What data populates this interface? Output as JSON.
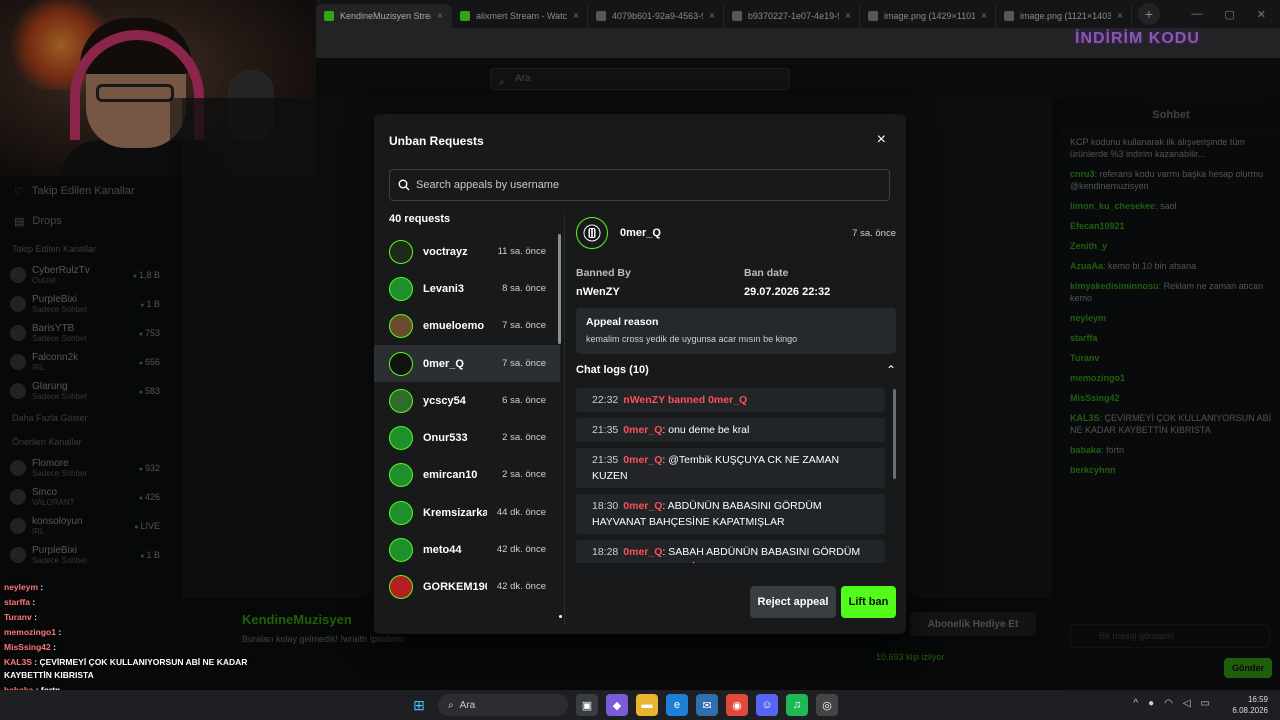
{
  "browser": {
    "tabs": [
      {
        "label": "KendineMuzisyen Stream",
        "color": "#53fc18",
        "active": true
      },
      {
        "label": "alixmert Stream - Watch",
        "color": "#53fc18",
        "active": false
      },
      {
        "label": "4079b601-92a9-4563-9b",
        "color": "#888888",
        "active": false
      },
      {
        "label": "b9370227-1e07-4e19-9b",
        "color": "#888888",
        "active": false
      },
      {
        "label": "image.png (1429×1101)",
        "color": "#888888",
        "active": false
      },
      {
        "label": "image.png (1121×1403)",
        "color": "#888888",
        "active": false
      }
    ],
    "new_tab": "+"
  },
  "site": {
    "search_placeholder": "Ara",
    "promo": "İNDİRİM KODU"
  },
  "left_sidebar": {
    "nav_followed": "Takip Edilen Kanallar",
    "nav_drops": "Drops",
    "followed_heading": "Takip Edilen Kanallar",
    "followed": [
      {
        "name": "CyberRulzTv",
        "cat": "Outzel",
        "viewers": "1,8 B"
      },
      {
        "name": "PurpleBixi",
        "cat": "Sadece Sohbet",
        "viewers": "1 B"
      },
      {
        "name": "BarisYTB",
        "cat": "Sadece Sohbet",
        "viewers": "753"
      },
      {
        "name": "Falconn2k",
        "cat": "IRL",
        "viewers": "656"
      },
      {
        "name": "Glarung",
        "cat": "Sadece Sohbet",
        "viewers": "583"
      }
    ],
    "more": "Daha Fazla Göster",
    "recommended_heading": "Önerilen Kanallar",
    "recommended": [
      {
        "name": "Flomore",
        "cat": "Sadece Sohbet",
        "viewers": "932"
      },
      {
        "name": "Sinco",
        "cat": "VALORANT",
        "viewers": "426"
      },
      {
        "name": "konsoloyun",
        "cat": "IRL",
        "viewers": "LIVE"
      },
      {
        "name": "PurpleBixi",
        "cat": "Sadece Sohbet",
        "viewers": "1 B"
      }
    ]
  },
  "overlay_chat": [
    {
      "user": "neyleym",
      "text": ""
    },
    {
      "user": "starffa",
      "text": ""
    },
    {
      "user": "Turanv",
      "text": ""
    },
    {
      "user": "memozingo1",
      "text": ""
    },
    {
      "user": "MisSsing42",
      "text": ""
    },
    {
      "user": "KAL3S",
      "text": "ÇEVİRMEYİ ÇOK KULLANIYORSUN ABİ NE KADAR KAYBETTİN KIBRISTA"
    },
    {
      "user": "babaka",
      "text": "fortn"
    },
    {
      "user": "berkcyhnn",
      "text": ""
    }
  ],
  "stream": {
    "streamer": "KendineMuzisyen",
    "title": "Buraları kolay gelmedik! !wraith !pindirim",
    "category": "Sadece Sohbet",
    "lang": "Turkish",
    "viewers": "10.693 kişi izliyor",
    "sub_button": "Abonelik Hediye Et"
  },
  "right_chat": {
    "title": "Sohbet",
    "pinned": "KCP kodunu kullanarak ilk alışverişinde tüm ürünlerde %3 indirim kazanabilir...",
    "messages": [
      {
        "user": "cnru3",
        "text": "referans kodu varmı başka hesap olurmu @kendinemuzisyen"
      },
      {
        "user": "limon_ku_chesekee",
        "text": "saol"
      },
      {
        "user": "Efecan10921",
        "text": ""
      },
      {
        "user": "Zenith_y",
        "text": ""
      },
      {
        "user": "AzuaAa",
        "text": "kemo bi 10 bin atsana"
      },
      {
        "user": "kimyakedisiminnosu",
        "text": "Reklam ne zaman atıcan kemo"
      },
      {
        "user": "neyleym",
        "text": ""
      },
      {
        "user": "starffa",
        "text": ""
      },
      {
        "user": "Turanv",
        "text": ""
      },
      {
        "user": "memozingo1",
        "text": ""
      },
      {
        "user": "MisSsing42",
        "text": ""
      },
      {
        "user": "KAL3S",
        "text": "ÇEVİRMEYİ ÇOK KULLANIYORSUN ABİ NE KADAR KAYBETTİN KIBRISTA"
      },
      {
        "user": "babaka",
        "text": "fortn"
      },
      {
        "user": "berkcyhnn",
        "text": ""
      }
    ],
    "input_placeholder": "Bir mesaj gönderin",
    "send": "Gönder"
  },
  "modal": {
    "title": "Unban Requests",
    "close": "×",
    "search_placeholder": "Search appeals by username",
    "count": "40 requests",
    "requests": [
      {
        "name": "voctrayz",
        "time": "11 sa. önce",
        "color": "#1f2a1a",
        "selected": false
      },
      {
        "name": "Levani3",
        "time": "8 sa. önce",
        "color": "#1e8f2a",
        "selected": false
      },
      {
        "name": "emueloemo",
        "time": "7 sa. önce",
        "color": "#6a4a2a",
        "selected": false
      },
      {
        "name": "0mer_Q",
        "time": "7 sa. önce",
        "color": "#111111",
        "selected": true
      },
      {
        "name": "ycscy54",
        "time": "6 sa. önce",
        "color": "#2f6b2a",
        "selected": false
      },
      {
        "name": "Onur533",
        "time": "2 sa. önce",
        "color": "#1e8f2a",
        "selected": false
      },
      {
        "name": "emircan10",
        "time": "2 sa. önce",
        "color": "#1e8f2a",
        "selected": false
      },
      {
        "name": "Kremsizarkadan1",
        "time": "44 dk. önce",
        "color": "#1e8f2a",
        "selected": false
      },
      {
        "name": "meto44",
        "time": "42 dk. önce",
        "color": "#1e8f2a",
        "selected": false
      },
      {
        "name": "GORKEM1905",
        "time": "42 dk. önce",
        "color": "#b3201f",
        "selected": false
      }
    ],
    "detail": {
      "user": "0mer_Q",
      "time": "7 sa. önce",
      "banned_by_label": "Banned By",
      "banned_by": "nWenZY",
      "ban_date_label": "Ban date",
      "ban_date": "29.07.2026 22:32",
      "appeal_label": "Appeal reason",
      "appeal_text": "kemalim cross yedik de uygunsa acar mısın be kingo",
      "chat_logs_label": "Chat logs (10)",
      "logs": [
        {
          "time": "22:32",
          "user": "nWenZY banned 0mer_Q",
          "text": ""
        },
        {
          "time": "21:35",
          "user": "0mer_Q",
          "text": ": onu deme be kral"
        },
        {
          "time": "21:35",
          "user": "0mer_Q",
          "text": ": @Tembik KUŞÇUYA CK NE ZAMAN KUZEN"
        },
        {
          "time": "18:30",
          "user": "0mer_Q",
          "text": ": ABDÜNÜN BABASINI GÖRDÜM HAYVANAT BAHÇESİNE KAPATMIŞLAR"
        },
        {
          "time": "18:28",
          "user": "0mer_Q",
          "text": ": SABAH ABDÜNÜN BABASINI GÖRDÜM HAYVANAT BAHÇESİNE KAPATMIŞLAR"
        }
      ]
    },
    "reject_label": "Reject appeal",
    "lift_label": "Lift ban"
  },
  "taskbar": {
    "search": "Ara",
    "time": "16:59",
    "date": "6.08.2026"
  }
}
